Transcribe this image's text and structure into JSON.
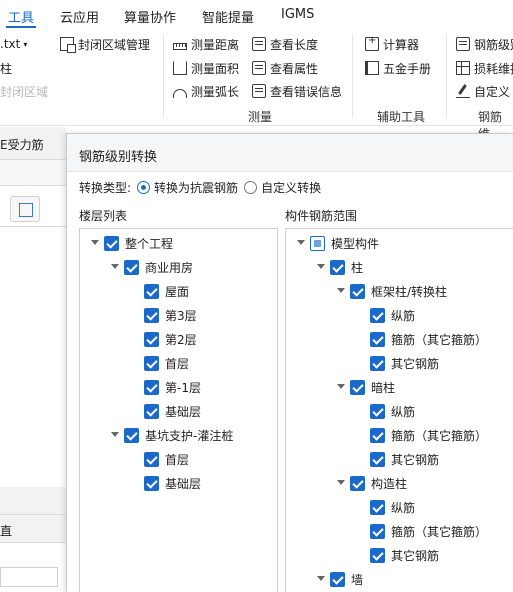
{
  "menu": {
    "items": [
      {
        "label": "工具",
        "active": true
      },
      {
        "label": "云应用",
        "active": false
      },
      {
        "label": "算量协作",
        "active": false
      },
      {
        "label": "智能提量",
        "active": false
      },
      {
        "label": "IGMS",
        "active": false
      }
    ]
  },
  "ribbon": {
    "left_partial": {
      "file_label": ".txt",
      "row2": "柱",
      "row3": "封闭区域"
    },
    "closed_region": "封闭区域管理",
    "measure": {
      "distance": "测量距离",
      "area": "测量面积",
      "arc": "测量弧长",
      "length": "查看长度",
      "attributes": "查看属性",
      "errors": "查看错误信息",
      "group_label": "测量"
    },
    "aux": {
      "calculator": "计算器",
      "hardware": "五金手册",
      "group_label": "辅助工具"
    },
    "rebar": {
      "level": "钢筋级别",
      "loss": "损耗维护",
      "custom": "自定义",
      "group_label": "钢筋维"
    }
  },
  "left_panel": {
    "top_text": "E受力筋",
    "bottom_text": "直"
  },
  "dialog": {
    "title": "钢筋级别转换",
    "conversion": {
      "label": "转换类型:",
      "option_seismic": "转换为抗震钢筋",
      "option_custom": "自定义转换",
      "selected": "option_seismic"
    },
    "floor_list_label": "楼层列表",
    "rebar_scope_label": "构件钢筋范围",
    "floor_tree": [
      {
        "label": "整个工程",
        "level": 0,
        "caret": true,
        "state": "checked"
      },
      {
        "label": "商业用房",
        "level": 1,
        "caret": true,
        "state": "checked"
      },
      {
        "label": "屋面",
        "level": 2,
        "caret": false,
        "state": "checked"
      },
      {
        "label": "第3层",
        "level": 2,
        "caret": false,
        "state": "checked"
      },
      {
        "label": "第2层",
        "level": 2,
        "caret": false,
        "state": "checked"
      },
      {
        "label": "首层",
        "level": 2,
        "caret": false,
        "state": "checked"
      },
      {
        "label": "第-1层",
        "level": 2,
        "caret": false,
        "state": "checked"
      },
      {
        "label": "基础层",
        "level": 2,
        "caret": false,
        "state": "checked"
      },
      {
        "label": "基坑支护-灌注桩",
        "level": 1,
        "caret": true,
        "state": "checked"
      },
      {
        "label": "首层",
        "level": 2,
        "caret": false,
        "state": "checked"
      },
      {
        "label": "基础层",
        "level": 2,
        "caret": false,
        "state": "checked"
      }
    ],
    "component_tree": [
      {
        "label": "模型构件",
        "level": 0,
        "caret": true,
        "state": "partial"
      },
      {
        "label": "柱",
        "level": 1,
        "caret": true,
        "state": "checked"
      },
      {
        "label": "框架柱/转换柱",
        "level": 2,
        "caret": true,
        "state": "checked"
      },
      {
        "label": "纵筋",
        "level": 3,
        "caret": false,
        "state": "checked"
      },
      {
        "label": "箍筋（其它箍筋）",
        "level": 3,
        "caret": false,
        "state": "checked"
      },
      {
        "label": "其它钢筋",
        "level": 3,
        "caret": false,
        "state": "checked"
      },
      {
        "label": "暗柱",
        "level": 2,
        "caret": true,
        "state": "checked"
      },
      {
        "label": "纵筋",
        "level": 3,
        "caret": false,
        "state": "checked"
      },
      {
        "label": "箍筋（其它箍筋）",
        "level": 3,
        "caret": false,
        "state": "checked"
      },
      {
        "label": "其它钢筋",
        "level": 3,
        "caret": false,
        "state": "checked"
      },
      {
        "label": "构造柱",
        "level": 2,
        "caret": true,
        "state": "checked"
      },
      {
        "label": "纵筋",
        "level": 3,
        "caret": false,
        "state": "checked"
      },
      {
        "label": "箍筋（其它箍筋）",
        "level": 3,
        "caret": false,
        "state": "checked"
      },
      {
        "label": "其它钢筋",
        "level": 3,
        "caret": false,
        "state": "checked"
      },
      {
        "label": "墙",
        "level": 1,
        "caret": true,
        "state": "checked"
      }
    ]
  },
  "colors": {
    "accent": "#1b6ac9",
    "partial": "#6fa3dd"
  }
}
